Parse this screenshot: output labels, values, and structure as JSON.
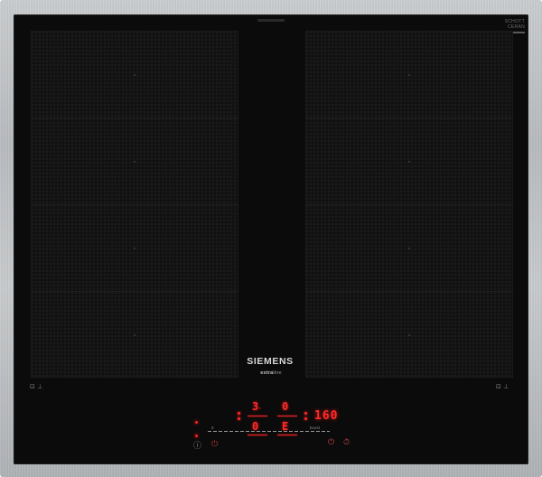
{
  "hob": {
    "brand": "SIEMENS",
    "model_prefix": "extra",
    "model_suffix": "line",
    "glass_brand_line1": "SCHOTT",
    "glass_brand_line2": "CERAN",
    "zone_icon": "⊡ ⊥",
    "colors": {
      "glass": "#0b0b0b",
      "frame": "#bfc2c4",
      "display": "#ff2a2a"
    }
  },
  "controls": {
    "left_zone_level": "3",
    "left_zone_sub": "·",
    "right_zone_level": "0",
    "left_zone_level_2": "0",
    "right_zone_level_2": "E",
    "timer_value": "160",
    "slider_min": "0",
    "slider_max": "boost",
    "info_icon": "ⓘ",
    "child_lock_icon": "🔒",
    "power_icon": "⏻",
    "timer_icon": "⏱"
  }
}
